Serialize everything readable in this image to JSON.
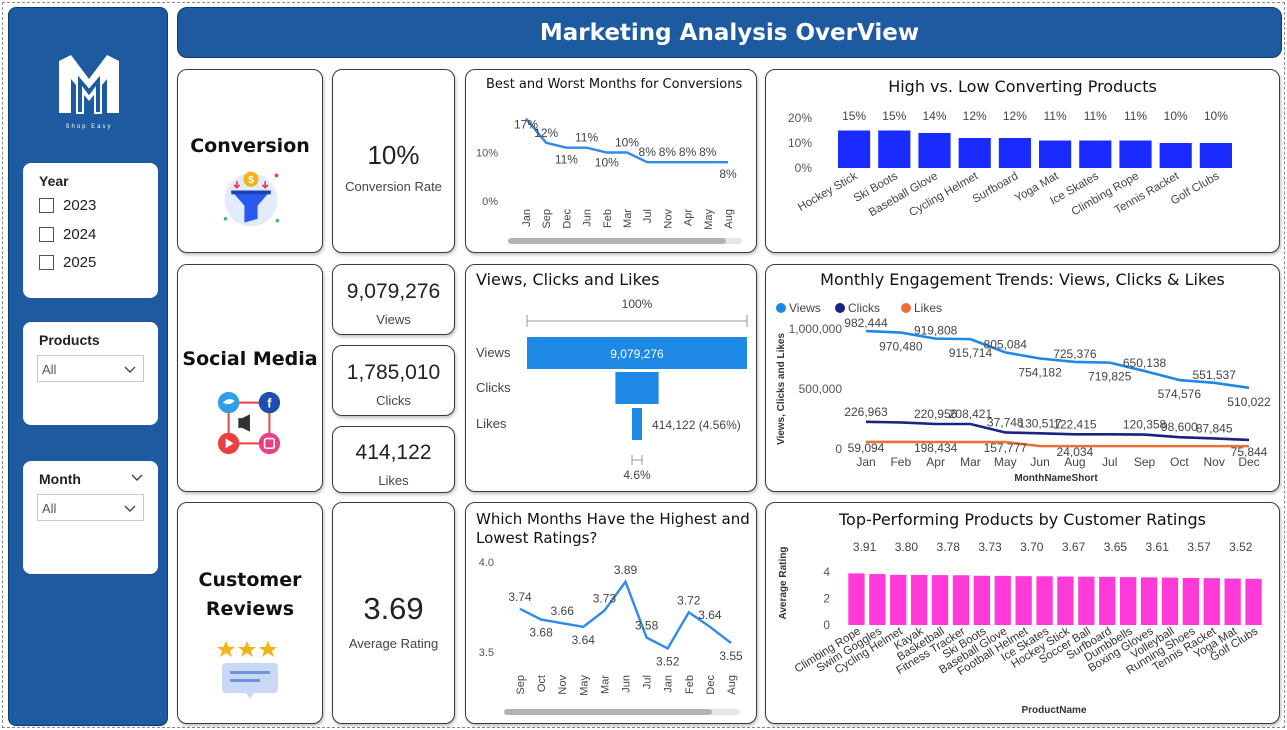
{
  "header": {
    "title": "Marketing Analysis OverView"
  },
  "sidebar": {
    "logo_text": "Shop Easy",
    "year": {
      "title": "Year",
      "options": [
        "2023",
        "2024",
        "2025"
      ]
    },
    "products": {
      "title": "Products",
      "selected": "All"
    },
    "month": {
      "title": "Month",
      "selected": "All"
    }
  },
  "sections": {
    "conversion": "Conversion",
    "social": "Social Media",
    "reviews_line1": "Customer",
    "reviews_line2": "Reviews"
  },
  "kpis": {
    "conversion_rate": {
      "value": "10%",
      "label": "Conversion Rate"
    },
    "views": {
      "value": "9,079,276",
      "label": "Views"
    },
    "clicks": {
      "value": "1,785,010",
      "label": "Clicks"
    },
    "likes": {
      "value": "414,122",
      "label": "Likes"
    },
    "avg_rating": {
      "value": "3.69",
      "label": "Average Rating"
    }
  },
  "colors": {
    "brand": "#1e5aa0",
    "line_blue": "#2f8ae8",
    "bar_blue": "#1a2bff",
    "views": "#1e88e5",
    "clicks": "#1a237e",
    "likes": "#e8703a",
    "magenta": "#ff3ad9",
    "funnel": "#1e88e5"
  },
  "chart_data": [
    {
      "id": "best_worst_months",
      "type": "line",
      "title": "Best and Worst Months for Conversions",
      "categories": [
        "Jan",
        "Sep",
        "Dec",
        "Jun",
        "Feb",
        "Mar",
        "Jul",
        "Nov",
        "Apr",
        "May",
        "Aug"
      ],
      "values": [
        17,
        12,
        11,
        11,
        10,
        10,
        8,
        8,
        8,
        8,
        8
      ],
      "data_labels": [
        "17%",
        "12%",
        "11%",
        "11%",
        "10%",
        "10%",
        "8%",
        "8%",
        "8%",
        "8%",
        "8%"
      ],
      "y_ticks": [
        "0%",
        "10%"
      ],
      "ylim": [
        0,
        20
      ]
    },
    {
      "id": "high_low_products",
      "type": "bar",
      "title": "High vs. Low Converting Products",
      "categories": [
        "Hockey Stick",
        "Ski Boots",
        "Baseball Glove",
        "Cycling Helmet",
        "Surfboard",
        "Yoga Mat",
        "Ice Skates",
        "Climbing Rope",
        "Tennis Racket",
        "Golf Clubs"
      ],
      "values": [
        15,
        15,
        14,
        12,
        12,
        11,
        11,
        11,
        10,
        10
      ],
      "data_labels": [
        "15%",
        "15%",
        "14%",
        "12%",
        "12%",
        "11%",
        "11%",
        "11%",
        "10%",
        "10%"
      ],
      "y_ticks": [
        "0%",
        "10%",
        "20%"
      ],
      "ylim": [
        0,
        20
      ]
    },
    {
      "id": "funnel",
      "type": "funnel",
      "title": "Views, Clicks and Likes",
      "categories": [
        "Views",
        "Clicks",
        "Likes"
      ],
      "values": [
        9079276,
        1785010,
        414122
      ],
      "data_labels": [
        "9,079,276",
        "",
        "414,122 (4.56%)"
      ],
      "top_pct": "100%",
      "bottom_pct": "4.6%"
    },
    {
      "id": "engagement_trends",
      "type": "line",
      "title": "Monthly Engagement Trends: Views, Clicks & Likes",
      "xlabel": "MonthNameShort",
      "ylabel": "Views, Clicks and Likes",
      "categories": [
        "Jan",
        "Feb",
        "Apr",
        "Mar",
        "May",
        "Jun",
        "Aug",
        "Jul",
        "Sep",
        "Oct",
        "Nov",
        "Dec"
      ],
      "y_ticks": [
        "0",
        "500,000",
        "1,000,000"
      ],
      "ylim": [
        0,
        1000000
      ],
      "series": [
        {
          "name": "Views",
          "values": [
            982444,
            970480,
            919808,
            915714,
            805084,
            754182,
            725376,
            719825,
            650138,
            574576,
            551537,
            510022
          ],
          "labels": [
            "982,444",
            "970,480",
            "919,808",
            "915,714",
            "805,084",
            "754,182",
            "725,376",
            "719,825",
            "650,138",
            "574,576",
            "551,537",
            "510,022"
          ]
        },
        {
          "name": "Clicks",
          "values": [
            226963,
            220956,
            208421,
            208421,
            137748,
            130517,
            122415,
            122415,
            120358,
            98600,
            87845,
            75844
          ],
          "labels": [
            "226,963",
            "",
            "220,956",
            "208,421",
            "37,748",
            "130,517",
            "122,415",
            "",
            "120,358",
            "98,600",
            "87,845",
            ""
          ]
        },
        {
          "name": "Likes",
          "values": [
            59094,
            59094,
            58434,
            57777,
            57777,
            24034,
            24034,
            24034,
            24034,
            24034,
            24034,
            24034
          ],
          "labels": [
            "59,094",
            "",
            "198,434",
            "",
            "157,777",
            "",
            "24,034",
            "",
            "",
            "",
            "",
            "75,844"
          ]
        }
      ]
    },
    {
      "id": "month_ratings",
      "type": "line",
      "title": "Which Months Have the Highest and Lowest Ratings?",
      "categories": [
        "Sep",
        "Oct",
        "Nov",
        "May",
        "Mar",
        "Jun",
        "Jul",
        "Jan",
        "Feb",
        "Dec",
        "Aug"
      ],
      "values": [
        3.74,
        3.68,
        3.66,
        3.64,
        3.73,
        3.89,
        3.58,
        3.52,
        3.72,
        3.64,
        3.55
      ],
      "data_labels": [
        "3.74",
        "3.68",
        "3.66",
        "3.64",
        "3.73",
        "3.89",
        "3.58",
        "3.52",
        "3.72",
        "3.64",
        "3.55"
      ],
      "y_ticks": [
        "3.5",
        "4.0"
      ],
      "ylim": [
        3.5,
        4.0
      ]
    },
    {
      "id": "product_ratings",
      "type": "bar",
      "title": "Top-Performing Products by Customer Ratings",
      "xlabel": "ProductName",
      "ylabel": "Average Rating",
      "categories": [
        "Climbing Rope",
        "Swim Goggles",
        "Cycling Helmet",
        "Kayak",
        "Basketball",
        "Fitness Tracker",
        "Ski Boots",
        "Baseball Glove",
        "Football Helmet",
        "Ice Skates",
        "Hockey Stick",
        "Soccer Ball",
        "Surfboard",
        "Dumbbells",
        "Boxing Gloves",
        "Volleyball",
        "Running Shoes",
        "Tennis Racket",
        "Yoga Mat",
        "Golf Clubs"
      ],
      "values": [
        3.91,
        3.86,
        3.8,
        3.79,
        3.78,
        3.77,
        3.73,
        3.72,
        3.7,
        3.69,
        3.67,
        3.66,
        3.65,
        3.63,
        3.61,
        3.59,
        3.57,
        3.55,
        3.52,
        3.5
      ],
      "data_labels": [
        "3.91",
        "",
        "3.80",
        "",
        "3.78",
        "",
        "3.73",
        "",
        "3.70",
        "",
        "3.67",
        "",
        "3.65",
        "",
        "3.61",
        "",
        "3.57",
        "",
        "3.52",
        ""
      ],
      "y_ticks": [
        "0",
        "2",
        "4"
      ],
      "ylim": [
        0,
        5
      ]
    }
  ]
}
